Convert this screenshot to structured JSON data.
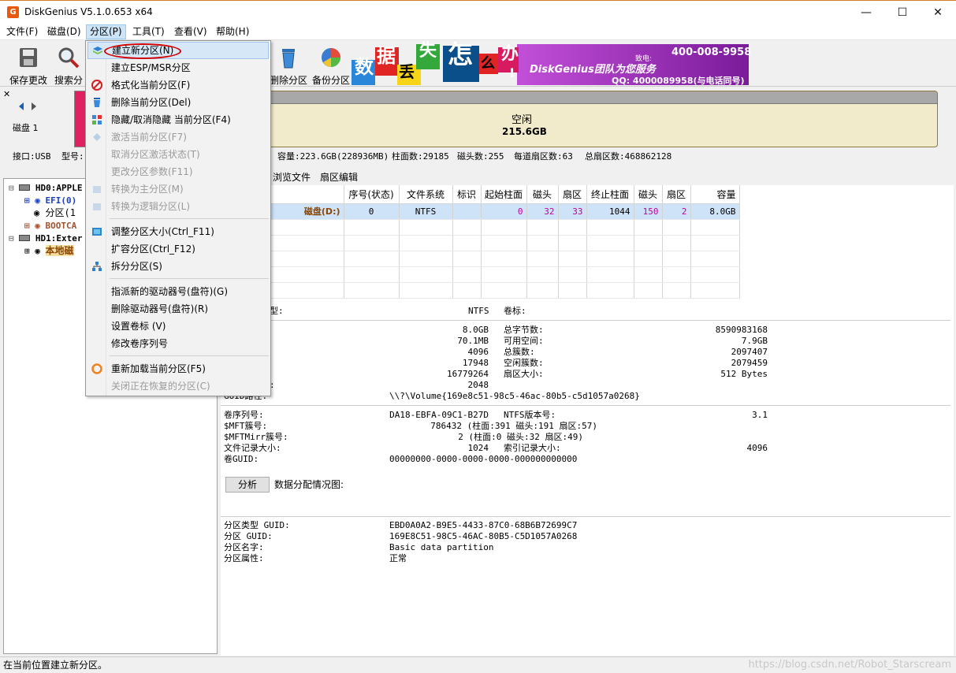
{
  "window": {
    "title": "DiskGenius V5.1.0.653 x64",
    "app_icon": "diskgenius-icon",
    "controls": [
      "minimize-icon",
      "maximize-icon",
      "close-icon"
    ]
  },
  "menubar": {
    "items": [
      "文件(F)",
      "磁盘(D)",
      "分区(P)",
      "工具(T)",
      "查看(V)",
      "帮助(H)"
    ],
    "active": "分区(P)"
  },
  "toolbar": {
    "buttons": [
      "保存更改",
      "搜索分区",
      "删除分区",
      "备份分区"
    ],
    "banner": {
      "chars": [
        "数",
        "据",
        "丢",
        "失",
        "怎",
        "么",
        "办",
        "!"
      ],
      "slogan": "DiskGenius团队为您服务",
      "phone": "400-008-9958",
      "qq": "QQ: 4000089958(与电话同号)",
      "phone_label": "致电:"
    }
  },
  "disk_nav": {
    "label": "磁盘 1",
    "prev_icon": "chevron-left-icon",
    "next_icon": "chevron-right-icon"
  },
  "diskmap": {
    "free_label": "空闲",
    "free_size": "215.6GB"
  },
  "disk_info": {
    "interface": "接口:USB",
    "model": "型号:",
    "capacity": "容量:223.6GB(228936MB)",
    "cylinders": "柱面数:29185",
    "heads": "磁头数:255",
    "sectors_per_track": "每道扇区数:63",
    "total_sectors": "总扇区数:468862128"
  },
  "tree": {
    "items": [
      {
        "label": "HD0:APPLE",
        "level": 0,
        "style": "bold"
      },
      {
        "label": "EFI(0)",
        "level": 1,
        "style": "blue"
      },
      {
        "label": "分区(1",
        "level": 1,
        "style": "normal"
      },
      {
        "label": "BOOTCA",
        "level": 1,
        "style": "brown"
      },
      {
        "label": "HD1:Exter",
        "level": 0,
        "style": "bold"
      },
      {
        "label": "本地磁",
        "level": 1,
        "style": "selected"
      }
    ]
  },
  "tabs": [
    "浏览文件",
    "扇区编辑"
  ],
  "partition_table": {
    "columns": [
      "序号(状态)",
      "文件系统",
      "标识",
      "起始柱面",
      "磁头",
      "扇区",
      "终止柱面",
      "磁头",
      "扇区",
      "容量"
    ],
    "rows": [
      {
        "name": "磁盘(D:)",
        "cells": [
          "0",
          "NTFS",
          "",
          "0",
          "32",
          "33",
          "1044",
          "150",
          "2",
          "8.0GB"
        ]
      }
    ]
  },
  "details": {
    "fs_type_label": "型:",
    "fs_type_value": "NTFS",
    "volume_label": "卷标:",
    "left_values": [
      "8.0GB",
      "70.1MB",
      "4096",
      "17948",
      "16779264",
      "2048"
    ],
    "right_labels": [
      "总字节数:",
      "可用空间:",
      "总簇数:",
      "空闲簇数:",
      "扇区大小:"
    ],
    "right_values": [
      "8590983168",
      "7.9GB",
      "2097407",
      "2079459",
      "512 Bytes"
    ],
    "partial_label": ":",
    "guid_path_label": "GUID路径:",
    "guid_path": "\\\\?\\Volume{169e8c51-98c5-46ac-80b5-c5d1057a0268}",
    "ntfs_rows": [
      {
        "label": "卷序列号:",
        "value": "DA18-EBFA-09C1-B27D",
        "label2": "NTFS版本号:",
        "value2": "3.1"
      },
      {
        "label": "$MFT簇号:",
        "value": "786432 (柱面:391 磁头:191 扇区:57)",
        "label2": "",
        "value2": ""
      },
      {
        "label": "$MFTMirr簇号:",
        "value": "2 (柱面:0 磁头:32 扇区:49)",
        "label2": "",
        "value2": ""
      },
      {
        "label": "文件记录大小:",
        "value": "1024",
        "label2": "索引记录大小:",
        "value2": "4096"
      },
      {
        "label": "卷GUID:",
        "value": "00000000-0000-0000-0000-000000000000",
        "label2": "",
        "value2": ""
      }
    ],
    "analyze_button": "分析",
    "alloc_label": "数据分配情况图:",
    "guid_rows": [
      {
        "label": "分区类型 GUID:",
        "value": "EBD0A0A2-B9E5-4433-87C0-68B6B72699C7"
      },
      {
        "label": "分区 GUID:",
        "value": "169E8C51-98C5-46AC-80B5-C5D1057A0268"
      },
      {
        "label": "分区名字:",
        "value": "Basic data partition"
      },
      {
        "label": "分区属性:",
        "value": "正常"
      }
    ]
  },
  "dropdown": {
    "items": [
      {
        "label": "建立新分区(N)",
        "icon": "new-partition-icon",
        "state": "highlighted"
      },
      {
        "label": "建立ESP/MSR分区",
        "icon": "",
        "state": "normal"
      },
      {
        "label": "格式化当前分区(F)",
        "icon": "format-icon",
        "state": "normal"
      },
      {
        "label": "删除当前分区(Del)",
        "icon": "delete-icon",
        "state": "normal"
      },
      {
        "label": "隐藏/取消隐藏 当前分区(F4)",
        "icon": "hide-icon",
        "state": "normal"
      },
      {
        "label": "激活当前分区(F7)",
        "icon": "activate-icon",
        "state": "disabled"
      },
      {
        "label": "取消分区激活状态(T)",
        "icon": "",
        "state": "disabled"
      },
      {
        "label": "更改分区参数(F11)",
        "icon": "",
        "state": "disabled"
      },
      {
        "label": "转换为主分区(M)",
        "icon": "convert-primary-icon",
        "state": "disabled"
      },
      {
        "label": "转换为逻辑分区(L)",
        "icon": "convert-logical-icon",
        "state": "disabled"
      },
      {
        "label": "调整分区大小(Ctrl_F11)",
        "icon": "resize-icon",
        "state": "normal"
      },
      {
        "label": "扩容分区(Ctrl_F12)",
        "icon": "",
        "state": "normal"
      },
      {
        "label": "拆分分区(S)",
        "icon": "split-icon",
        "state": "normal"
      },
      {
        "label": "指派新的驱动器号(盘符)(G)",
        "icon": "",
        "state": "normal"
      },
      {
        "label": "删除驱动器号(盘符)(R)",
        "icon": "",
        "state": "normal"
      },
      {
        "label": "设置卷标 (V)",
        "icon": "",
        "state": "normal"
      },
      {
        "label": "修改卷序列号",
        "icon": "",
        "state": "normal"
      },
      {
        "label": "重新加载当前分区(F5)",
        "icon": "reload-icon",
        "state": "normal"
      },
      {
        "label": "关闭正在恢复的分区(C)",
        "icon": "",
        "state": "disabled"
      }
    ]
  },
  "statusbar": {
    "text": "在当前位置建立新分区。",
    "watermark": "https://blog.csdn.net/Robot_Starscream"
  },
  "colors": {
    "accent_orange": "#e8590c",
    "selection_blue": "#cfe3f8",
    "red_circle": "#d40000",
    "bar_red": "#c00000",
    "brown_label": "#8b4500"
  }
}
